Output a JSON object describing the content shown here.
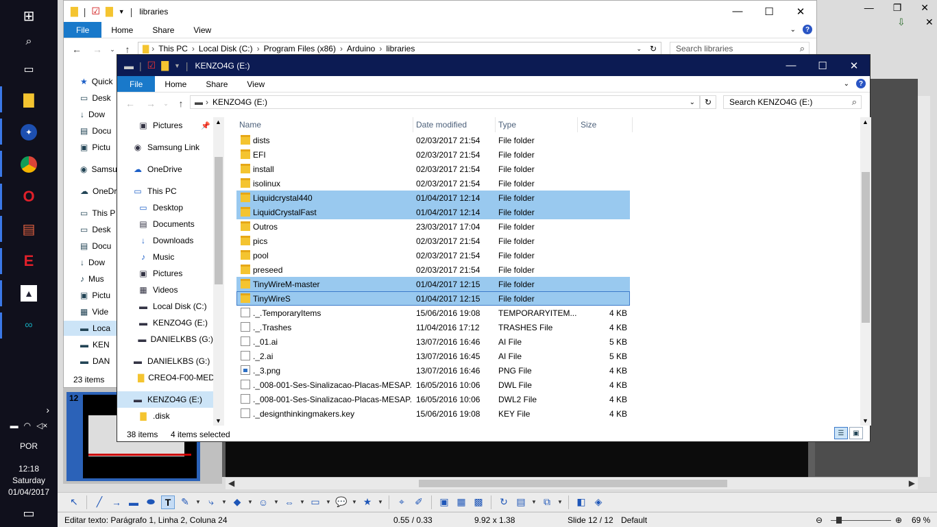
{
  "colors": {
    "taskbar": "#10101c",
    "explorer_title_active": "#0c1b53",
    "file_tab": "#1979ca",
    "selection": "#99c9ef",
    "folder": "#f4c430"
  },
  "taskbar": {
    "icons": [
      "windows-start-icon",
      "search-icon",
      "task-view-icon",
      "file-explorer-icon",
      "lightning-app-icon",
      "chrome-icon",
      "opera-icon",
      "library-app-icon",
      "e-app-icon",
      "photos-icon",
      "arduino-icon"
    ],
    "tray_icons": [
      "network-icon",
      "wifi-icon",
      "volume-icon"
    ],
    "tray_arrow": "›",
    "language": "POR",
    "time": "12:18",
    "day": "Saturday",
    "date": "01/04/2017"
  },
  "bgapp": {
    "controls": [
      "—",
      "❐",
      "✕"
    ],
    "slide_thumb_number": "12",
    "statusbar": {
      "edit_text": "Editar texto: Parágrafo 1, Linha 2, Coluna 24",
      "position": "0.55 / 0.33",
      "size": "9.92 x 1.38",
      "slide": "Slide 12 / 12",
      "layout": "Default",
      "zoom": "69 %",
      "zoom_level": 0.69
    }
  },
  "win1": {
    "title": "libraries",
    "tabs": {
      "file": "File",
      "home": "Home",
      "share": "Share",
      "view": "View"
    },
    "address": [
      "This PC",
      "Local Disk (C:)",
      "Program Files (x86)",
      "Arduino",
      "libraries"
    ],
    "search_placeholder": "Search libraries",
    "nav": [
      "Quick",
      "Desk",
      "Dow",
      "Docu",
      "Pictu",
      "Samsu",
      "OneDr",
      "This P",
      "Desk",
      "Docu",
      "Dow",
      "Mus",
      "Pictu",
      "Vide",
      "Loca",
      "KEN",
      "DAN"
    ],
    "status": "23 items"
  },
  "win2": {
    "title": "KENZO4G (E:)",
    "tabs": {
      "file": "File",
      "home": "Home",
      "share": "Share",
      "view": "View"
    },
    "address": "KENZO4G (E:)",
    "search_placeholder": "Search KENZO4G (E:)",
    "nav": [
      {
        "label": "Pictures",
        "icon": "pictures-icon",
        "pinned": true
      },
      {
        "label": "Samsung Link",
        "icon": "samsung-link-icon"
      },
      {
        "label": "OneDrive",
        "icon": "onedrive-icon"
      },
      {
        "label": "This PC",
        "icon": "this-pc-icon"
      },
      {
        "label": "Desktop",
        "icon": "desktop-icon"
      },
      {
        "label": "Documents",
        "icon": "documents-icon"
      },
      {
        "label": "Downloads",
        "icon": "downloads-icon"
      },
      {
        "label": "Music",
        "icon": "music-icon"
      },
      {
        "label": "Pictures",
        "icon": "pictures-icon"
      },
      {
        "label": "Videos",
        "icon": "videos-icon"
      },
      {
        "label": "Local Disk (C:)",
        "icon": "local-disk-icon"
      },
      {
        "label": "KENZO4G (E:)",
        "icon": "drive-icon"
      },
      {
        "label": "DANIELKBS (G:)",
        "icon": "drive-icon"
      },
      {
        "label": "DANIELKBS (G:)",
        "icon": "drive-icon"
      },
      {
        "label": "CREO4-F00-MED",
        "icon": "folder-icon"
      },
      {
        "label": "KENZO4G (E:)",
        "icon": "drive-icon",
        "selected": true
      },
      {
        "label": ".disk",
        "icon": "folder-icon"
      }
    ],
    "columns": {
      "name": "Name",
      "date": "Date modified",
      "type": "Type",
      "size": "Size"
    },
    "files": [
      {
        "name": "dists",
        "date": "02/03/2017 21:54",
        "type": "File folder",
        "size": "",
        "kind": "folder"
      },
      {
        "name": "EFI",
        "date": "02/03/2017 21:54",
        "type": "File folder",
        "size": "",
        "kind": "folder"
      },
      {
        "name": "install",
        "date": "02/03/2017 21:54",
        "type": "File folder",
        "size": "",
        "kind": "folder"
      },
      {
        "name": "isolinux",
        "date": "02/03/2017 21:54",
        "type": "File folder",
        "size": "",
        "kind": "folder"
      },
      {
        "name": "Liquidcrystal440",
        "date": "01/04/2017 12:14",
        "type": "File folder",
        "size": "",
        "kind": "folder",
        "selected": true
      },
      {
        "name": "LiquidCrystalFast",
        "date": "01/04/2017 12:14",
        "type": "File folder",
        "size": "",
        "kind": "folder",
        "selected": true
      },
      {
        "name": "Outros",
        "date": "23/03/2017 17:04",
        "type": "File folder",
        "size": "",
        "kind": "folder"
      },
      {
        "name": "pics",
        "date": "02/03/2017 21:54",
        "type": "File folder",
        "size": "",
        "kind": "folder"
      },
      {
        "name": "pool",
        "date": "02/03/2017 21:54",
        "type": "File folder",
        "size": "",
        "kind": "folder"
      },
      {
        "name": "preseed",
        "date": "02/03/2017 21:54",
        "type": "File folder",
        "size": "",
        "kind": "folder"
      },
      {
        "name": "TinyWireM-master",
        "date": "01/04/2017 12:15",
        "type": "File folder",
        "size": "",
        "kind": "folder",
        "selected": true
      },
      {
        "name": "TinyWireS",
        "date": "01/04/2017 12:15",
        "type": "File folder",
        "size": "",
        "kind": "folder",
        "selected": true,
        "focus": true
      },
      {
        "name": "._.TemporaryItems",
        "date": "15/06/2016 19:08",
        "type": "TEMPORARYITEM...",
        "size": "4 KB",
        "kind": "file"
      },
      {
        "name": "._.Trashes",
        "date": "11/04/2016 17:12",
        "type": "TRASHES File",
        "size": "4 KB",
        "kind": "file"
      },
      {
        "name": "._01.ai",
        "date": "13/07/2016 16:46",
        "type": "AI File",
        "size": "5 KB",
        "kind": "file"
      },
      {
        "name": "._2.ai",
        "date": "13/07/2016 16:45",
        "type": "AI File",
        "size": "5 KB",
        "kind": "file"
      },
      {
        "name": "._3.png",
        "date": "13/07/2016 16:46",
        "type": "PNG File",
        "size": "4 KB",
        "kind": "png"
      },
      {
        "name": "._008-001-Ses-Sinalizacao-Placas-MESAP...",
        "date": "16/05/2016 10:06",
        "type": "DWL File",
        "size": "4 KB",
        "kind": "file"
      },
      {
        "name": "._008-001-Ses-Sinalizacao-Placas-MESAP...",
        "date": "16/05/2016 10:06",
        "type": "DWL2 File",
        "size": "4 KB",
        "kind": "file"
      },
      {
        "name": "._designthinkingmakers.key",
        "date": "15/06/2016 19:08",
        "type": "KEY File",
        "size": "4 KB",
        "kind": "file"
      }
    ],
    "status_items": "38 items",
    "status_selected": "4 items selected"
  }
}
